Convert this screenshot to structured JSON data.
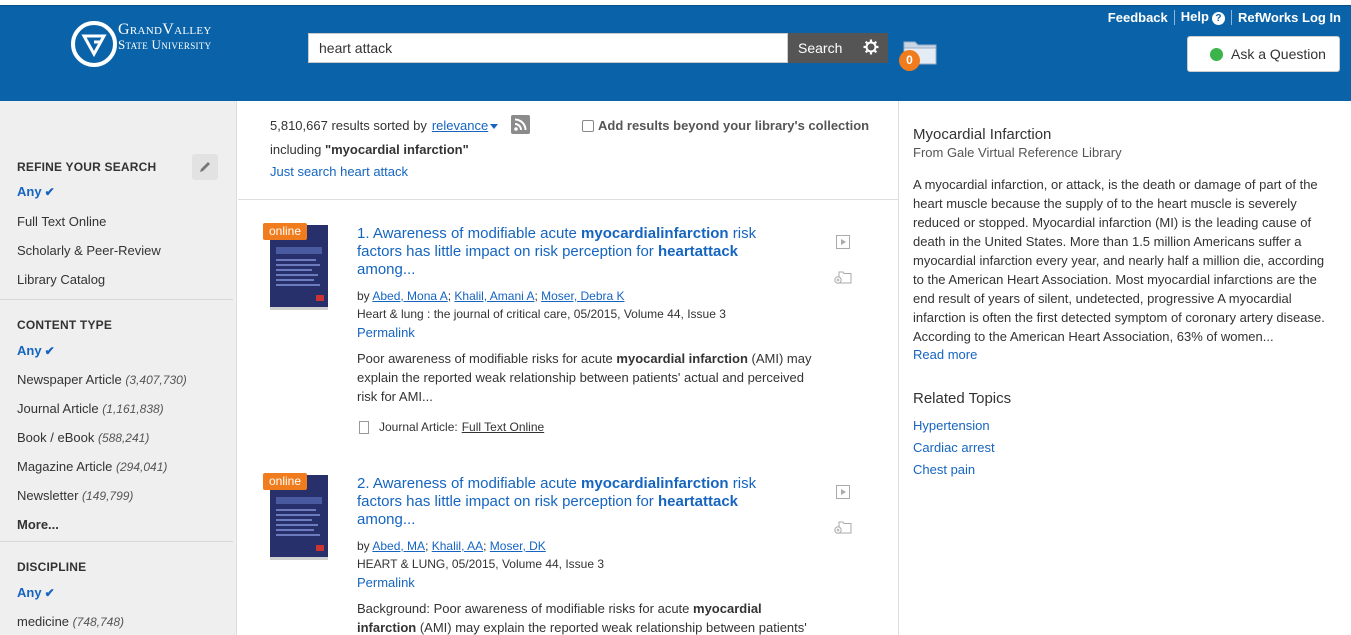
{
  "header": {
    "logo_line1": "GrandValley",
    "logo_line2": "State University",
    "search_value": "heart attack",
    "search_button": "Search",
    "folder_count": "0",
    "links": {
      "feedback": "Feedback",
      "help": "Help",
      "help_glyph": "?",
      "refworks": "RefWorks Log In"
    },
    "ask_question": "Ask a Question",
    "colors": {
      "bar": "#0a63a8",
      "accent": "#f07c1d",
      "online_dot": "#3bb54a"
    }
  },
  "sidebar": {
    "refine_heading": "REFINE YOUR SEARCH",
    "refine_any": "Any",
    "refine_items": [
      "Full Text Online",
      "Scholarly & Peer-Review",
      "Library Catalog"
    ],
    "content_heading": "CONTENT TYPE",
    "content_any": "Any",
    "content_items": [
      {
        "label": "Newspaper Article",
        "count": "(3,407,730)"
      },
      {
        "label": "Journal Article",
        "count": "(1,161,838)"
      },
      {
        "label": "Book / eBook",
        "count": "(588,241)"
      },
      {
        "label": "Magazine Article",
        "count": "(294,041)"
      },
      {
        "label": "Newsletter",
        "count": "(149,799)"
      }
    ],
    "content_more": "More...",
    "discipline_heading": "DISCIPLINE",
    "discipline_any": "Any",
    "discipline_items": [
      {
        "label": "medicine",
        "count": "(748,748)"
      }
    ]
  },
  "results_header": {
    "count_text": "5,810,667 results sorted by",
    "sort": "relevance",
    "beyond": "Add results beyond your library's collection",
    "including_prefix": "including",
    "including_term": "\"myocardial infarction\"",
    "just_search": "Just search heart attack"
  },
  "results": [
    {
      "badge": "online",
      "title_parts": [
        "1. Awareness of modifiable acute ",
        "myocardialinfarction",
        " risk factors has little impact on risk perception for ",
        "heartattack",
        " among..."
      ],
      "by": "by",
      "authors": [
        "Abed, Mona A",
        "Khalil, Amani A",
        "Moser, Debra K"
      ],
      "source": "Heart & lung : the journal of critical care, 05/2015, Volume 44, Issue 3",
      "permalink": "Permalink",
      "abstract_parts": [
        "Poor awareness of modifiable risks for acute ",
        "myocardial infarction",
        " (AMI) may explain the reported weak relationship between patients' actual and perceived risk for AMI..."
      ],
      "format_label": "Journal Article:",
      "format_link": "Full Text Online"
    },
    {
      "badge": "online",
      "title_parts": [
        "2. Awareness of modifiable acute ",
        "myocardialinfarction",
        " risk factors has little impact on risk perception for ",
        "heartattack",
        " among..."
      ],
      "by": "by",
      "authors": [
        "Abed, MA",
        "Khalil, AA",
        "Moser, DK"
      ],
      "source": "HEART & LUNG, 05/2015, Volume 44, Issue 3",
      "permalink": "Permalink",
      "abstract_parts": [
        "Background: Poor awareness of modifiable risks for acute ",
        "myocardial infarction",
        " (AMI) may explain the reported weak relationship between patients'"
      ]
    }
  ],
  "topic_panel": {
    "title": "Myocardial Infarction",
    "from": "From Gale Virtual Reference Library",
    "body": "A myocardial infarction, or attack, is the death or damage of part of the heart muscle because the supply of to the heart muscle is severely reduced or stopped. Myocardial infarction (MI) is the leading cause of death in the United States. More than 1.5 million Americans suffer a myocardial infarction every year, and nearly half a million die, according to the American Heart Association. Most myocardial infarctions are the end result of years of silent, undetected, progressive A myocardial infarction is often the first detected symptom of coronary artery disease. According to the American Heart Association, 63% of women...",
    "read_more": "Read more",
    "related_heading": "Related Topics",
    "related": [
      "Hypertension",
      "Cardiac arrest",
      "Chest pain"
    ]
  }
}
